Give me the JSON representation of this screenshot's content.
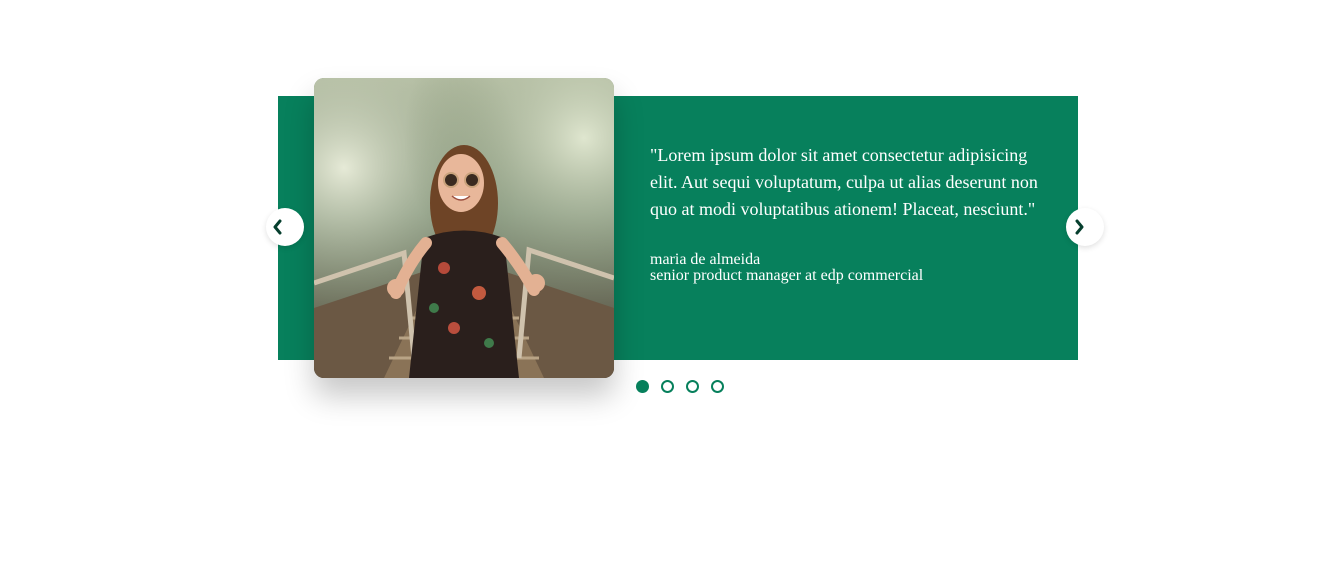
{
  "colors": {
    "accent": "#07805c",
    "text_on_accent": "#ffffff",
    "background": "#ffffff"
  },
  "testimonial": {
    "quote": "\"Lorem ipsum dolor sit amet consectetur adipisicing elit. Aut sequi voluptatum, culpa ut alias deserunt non quo at modi voluptatibus ationem! Placeat, nesciunt.\"",
    "author_name": "maria de almeida",
    "author_title": "senior product manager at edp commercial"
  },
  "navigation": {
    "prev_icon": "chevron-left-icon",
    "next_icon": "chevron-right-icon"
  },
  "pagination": {
    "total": 4,
    "active_index": 0
  }
}
